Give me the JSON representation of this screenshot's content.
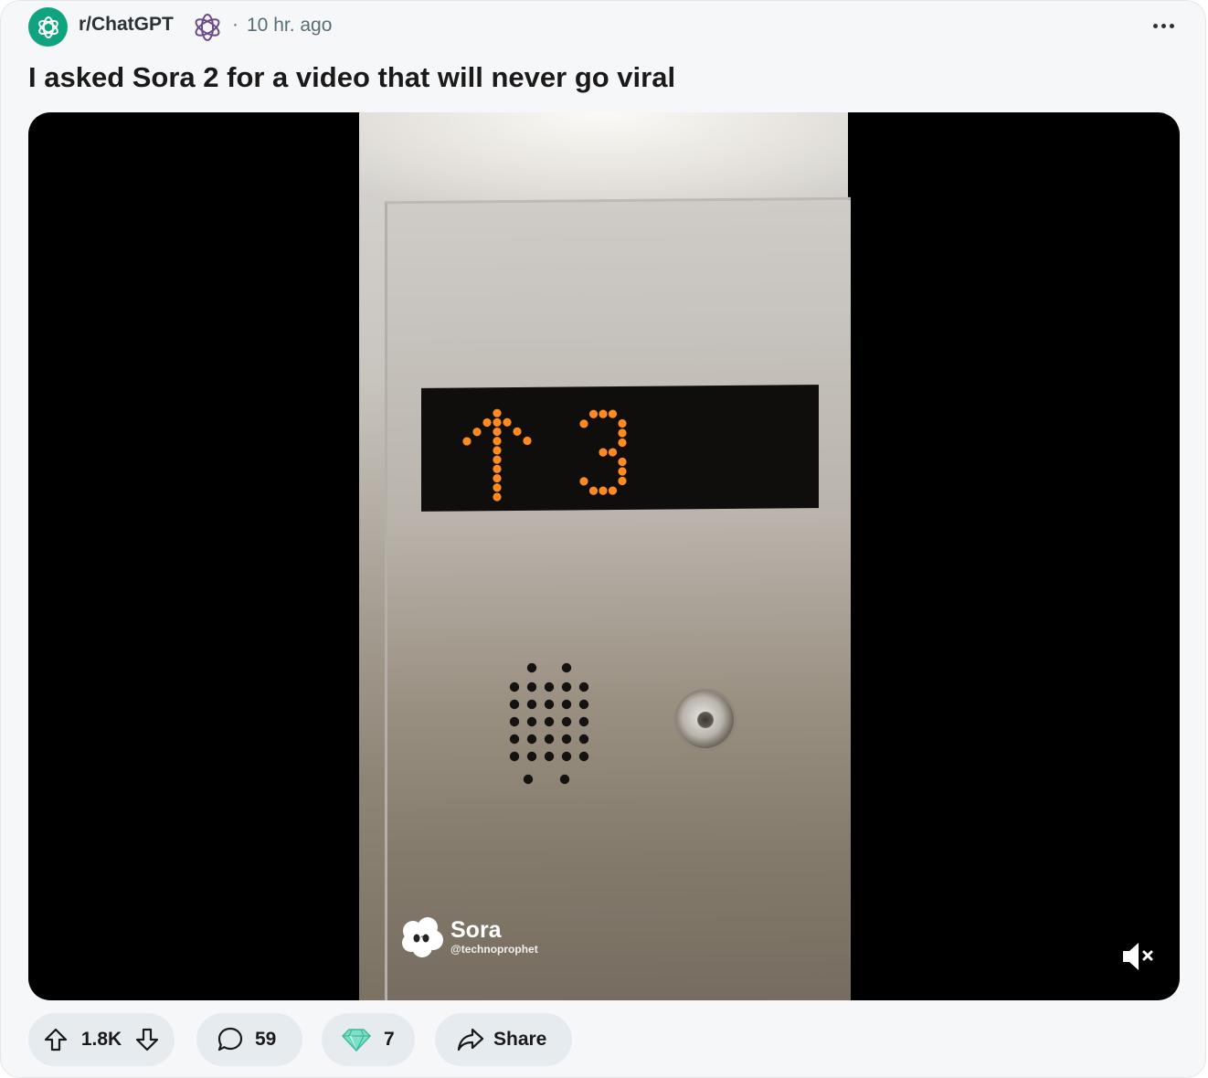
{
  "header": {
    "subreddit": "r/ChatGPT",
    "separator": "·",
    "time_ago": "10 hr. ago",
    "icons": [
      "openai-logo-icon",
      "flair-openai-icon",
      "more-options-icon"
    ]
  },
  "post": {
    "title": "I asked Sora 2 for a video that will never go viral"
  },
  "video": {
    "display_arrow": "up",
    "display_floor": "3",
    "watermark_name": "Sora",
    "watermark_handle": "@technoprophet",
    "muted": true,
    "led_color": "#ff8a1e"
  },
  "actions": {
    "votes": "1.8K",
    "comments": "59",
    "awards": "7",
    "share_label": "Share"
  },
  "colors": {
    "brand": "#10a37f",
    "pill_bg": "#e5ebee",
    "meta_text": "#576f76"
  }
}
